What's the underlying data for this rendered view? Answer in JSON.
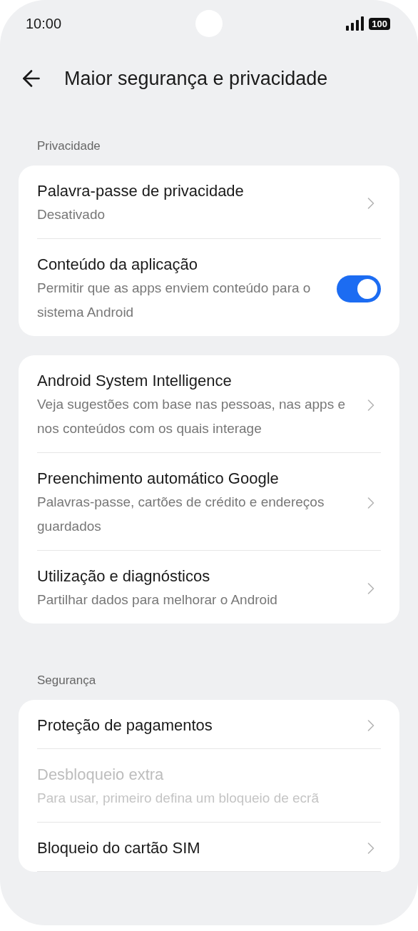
{
  "status_bar": {
    "time": "10:00",
    "battery": "100"
  },
  "header": {
    "title": "Maior segurança e privacidade"
  },
  "groups": [
    {
      "label": "Privacidade",
      "items": [
        {
          "kind": "link",
          "title": "Palavra-passe de privacidade",
          "subtitle": "Desativado",
          "disabled": false
        },
        {
          "kind": "toggle",
          "title": "Conteúdo da aplicação",
          "subtitle": "Permitir que as apps enviem conteúdo para o sistema Android",
          "on": true,
          "disabled": false
        }
      ]
    },
    {
      "items": [
        {
          "kind": "link",
          "title": "Android System Intelligence",
          "subtitle": "Veja sugestões com base nas pessoas, nas apps e nos conteúdos com os quais interage",
          "disabled": false
        },
        {
          "kind": "link",
          "title": "Preenchimento automático Google",
          "subtitle": "Palavras-passe, cartões de crédito e endereços guardados",
          "disabled": false
        },
        {
          "kind": "link",
          "title": "Utilização e diagnósticos",
          "subtitle": "Partilhar dados para melhorar o Android",
          "disabled": false
        }
      ]
    },
    {
      "label": "Segurança",
      "items": [
        {
          "kind": "link",
          "title": "Proteção de pagamentos",
          "disabled": false
        },
        {
          "kind": "plain",
          "title": "Desbloqueio extra",
          "subtitle": "Para usar, primeiro defina um bloqueio de ecrã",
          "disabled": true
        },
        {
          "kind": "link",
          "title": "Bloqueio do cartão SIM",
          "disabled": false
        }
      ]
    }
  ]
}
